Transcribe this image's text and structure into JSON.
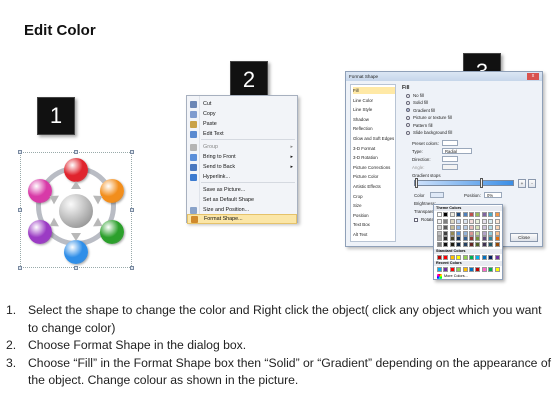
{
  "title": "Edit Color",
  "steps": [
    "1",
    "2",
    "3"
  ],
  "diagram": {
    "balls": [
      {
        "name": "red-ball",
        "color": "#e0242d"
      },
      {
        "name": "orange-ball",
        "color": "#f28e1c"
      },
      {
        "name": "green-ball",
        "color": "#2ca02c"
      },
      {
        "name": "blue-ball",
        "color": "#2f8ee8"
      },
      {
        "name": "purple-ball",
        "color": "#9b3bc4"
      },
      {
        "name": "magenta-ball",
        "color": "#d83aa8"
      }
    ],
    "center_color": "#a6a6a6",
    "arrow_color": "#b8b8b8"
  },
  "context_menu": {
    "items": [
      {
        "label": "Cut",
        "icon": "scissors-icon",
        "disabled": false,
        "submenu": false
      },
      {
        "label": "Copy",
        "icon": "copy-icon",
        "disabled": false,
        "submenu": false
      },
      {
        "label": "Paste",
        "icon": "paste-icon",
        "disabled": false,
        "submenu": false
      },
      {
        "label": "Edit Text",
        "icon": "edit-text-icon",
        "disabled": false,
        "submenu": false
      },
      {
        "label": "Group",
        "icon": "group-icon",
        "disabled": true,
        "submenu": true
      },
      {
        "label": "Bring to Front",
        "icon": "bring-front-icon",
        "disabled": false,
        "submenu": true
      },
      {
        "label": "Send to Back",
        "icon": "send-back-icon",
        "disabled": false,
        "submenu": true
      },
      {
        "label": "Hyperlink...",
        "icon": "hyperlink-icon",
        "disabled": false,
        "submenu": false
      },
      {
        "label": "Save as Picture...",
        "icon": "",
        "disabled": false,
        "submenu": false
      },
      {
        "label": "Set as Default Shape",
        "icon": "",
        "disabled": false,
        "submenu": false
      },
      {
        "label": "Size and Position...",
        "icon": "size-icon",
        "disabled": false,
        "submenu": false
      },
      {
        "label": "Format Shape...",
        "icon": "format-shape-icon",
        "disabled": false,
        "submenu": false,
        "highlighted": true
      }
    ]
  },
  "dialog": {
    "title": "Format Shape",
    "close": "x",
    "nav": [
      "Fill",
      "Line Color",
      "Line Style",
      "Shadow",
      "Reflection",
      "Glow and Soft Edges",
      "3-D Format",
      "3-D Rotation",
      "Picture Corrections",
      "Picture Color",
      "Artistic Effects",
      "Crop",
      "Size",
      "Position",
      "Text Box",
      "Alt Text"
    ],
    "nav_selected": "Fill",
    "section": "Fill",
    "radios": [
      "No fill",
      "Solid fill",
      "Gradient fill",
      "Picture or texture fill",
      "Pattern fill",
      "Slide background fill"
    ],
    "radio_selected": "Gradient fill",
    "fields": {
      "preset": "Preset colors:",
      "type": "Type:",
      "type_value": "Radial",
      "direction": "Direction:",
      "angle": "Angle:",
      "gradient_stops": "Gradient stops",
      "color": "Color",
      "position": "Position:",
      "position_value": "0%",
      "brightness": "Brightness:",
      "transparency": "Transparency:",
      "rotate": "Rotate with shape"
    },
    "close_button": "Close"
  },
  "palette": {
    "theme_header": "Theme Colors",
    "standard_header": "Standard Colors",
    "recent_header": "Recent Colors",
    "more": "More Colors...",
    "theme_top": [
      "#ffffff",
      "#000000",
      "#eeece1",
      "#1f497d",
      "#4f81bd",
      "#c0504d",
      "#9bbb59",
      "#8064a2",
      "#4bacc6",
      "#f79646"
    ],
    "theme_shades": [
      [
        "#f2f2f2",
        "#7f7f7f",
        "#ddd9c3",
        "#c6d9f0",
        "#dbe5f1",
        "#f2dcdb",
        "#ebf1dd",
        "#e5e0ec",
        "#dbeef3",
        "#fdeada"
      ],
      [
        "#d8d8d8",
        "#595959",
        "#c4bd97",
        "#8db3e2",
        "#b8cce4",
        "#e5b9b7",
        "#d7e3bc",
        "#ccc1d9",
        "#b7dde8",
        "#fbd5b5"
      ],
      [
        "#bfbfbf",
        "#3f3f3f",
        "#938953",
        "#548dd4",
        "#95b3d7",
        "#d99694",
        "#c3d69b",
        "#b2a2c7",
        "#92cddc",
        "#fac08f"
      ],
      [
        "#a5a5a5",
        "#262626",
        "#494429",
        "#17365d",
        "#366092",
        "#953734",
        "#76923c",
        "#5f497a",
        "#31859b",
        "#e36c09"
      ],
      [
        "#7f7f7f",
        "#0c0c0c",
        "#1d1b10",
        "#0f243e",
        "#244061",
        "#632423",
        "#4f6128",
        "#3f3151",
        "#205867",
        "#974806"
      ]
    ],
    "standard": [
      "#c00000",
      "#ff0000",
      "#ffc000",
      "#ffff00",
      "#92d050",
      "#00b050",
      "#00b0f0",
      "#0070c0",
      "#002060",
      "#7030a0"
    ],
    "recent": [
      "#00b0f0",
      "#7030a0",
      "#ff0000",
      "#92d050",
      "#ffc000",
      "#0070c0",
      "#c00000",
      "#ff66cc",
      "#00b050",
      "#ffff00"
    ]
  },
  "instructions": [
    {
      "num": "1.",
      "text": "Select the shape to change the color and Right click the object( click any object which you want to change color)"
    },
    {
      "num": "2.",
      "text": "Choose Format Shape in the dialog box."
    },
    {
      "num": "3.",
      "text": "Choose “Fill” in the Format Shape box then “Solid” or “Gradient” depending on the appearance of the object. Change colour as shown in the picture."
    }
  ]
}
